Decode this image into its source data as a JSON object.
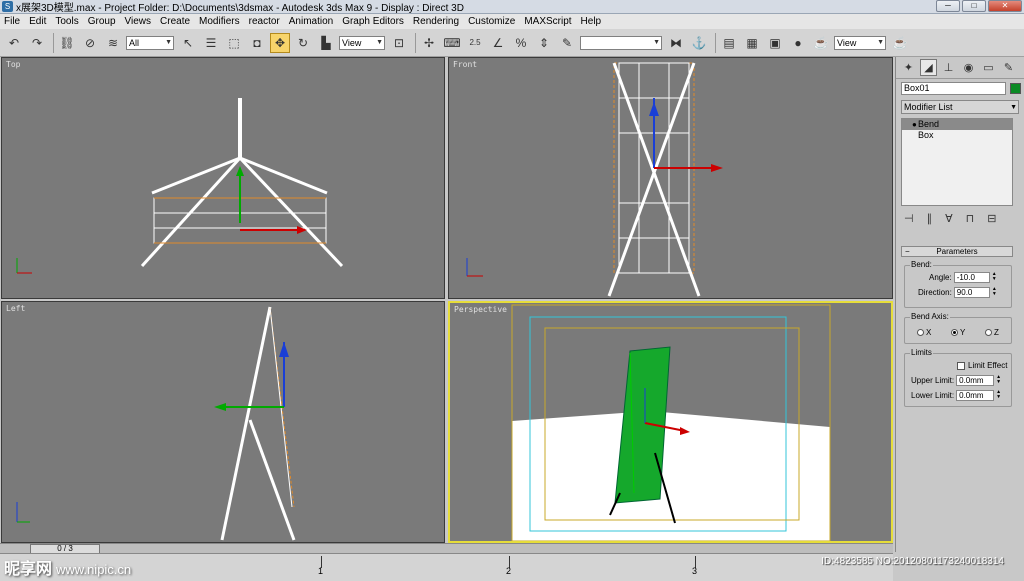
{
  "titlebar": {
    "title": "x展架3D模型.max    - Project Folder: D:\\Documents\\3dsmax    - Autodesk 3ds Max 9    - Display : Direct 3D",
    "minimize": "─",
    "maximize": "□",
    "close": "✕"
  },
  "menu": [
    "File",
    "Edit",
    "Tools",
    "Group",
    "Views",
    "Create",
    "Modifiers",
    "reactor",
    "Animation",
    "Graph Editors",
    "Rendering",
    "Customize",
    "MAXScript",
    "Help"
  ],
  "toolbar": {
    "filter_value": "All",
    "coord_value": "View",
    "selection_set_value": "",
    "view_value": "View",
    "snap_label": "2.5"
  },
  "viewports": {
    "top": "Top",
    "front": "Front",
    "left": "Left",
    "perspective": "Perspective"
  },
  "command_panel": {
    "object_name": "Box01",
    "object_color": "#0a8a24",
    "modifier_list": "Modifier List",
    "stack": [
      "Bend",
      "Box"
    ],
    "parameters_title": "Parameters",
    "bend_group": "Bend:",
    "angle_label": "Angle:",
    "angle_value": "-10.0",
    "direction_label": "Direction:",
    "direction_value": "90.0",
    "axis_group": "Bend Axis:",
    "axis_x": "X",
    "axis_y": "Y",
    "axis_z": "Z",
    "limits_group": "Limits",
    "limit_effect": "Limit Effect",
    "upper_label": "Upper Limit:",
    "upper_value": "0.0mm",
    "lower_label": "Lower Limit:",
    "lower_value": "0.0mm"
  },
  "timeline": {
    "frame_display": "0 / 3",
    "ticks": [
      "1",
      "2",
      "3"
    ]
  },
  "watermark": {
    "logo": "昵享网",
    "url": "www.nipic.cn",
    "id_line": "ID:4823585 NO:20120801173240018314"
  }
}
